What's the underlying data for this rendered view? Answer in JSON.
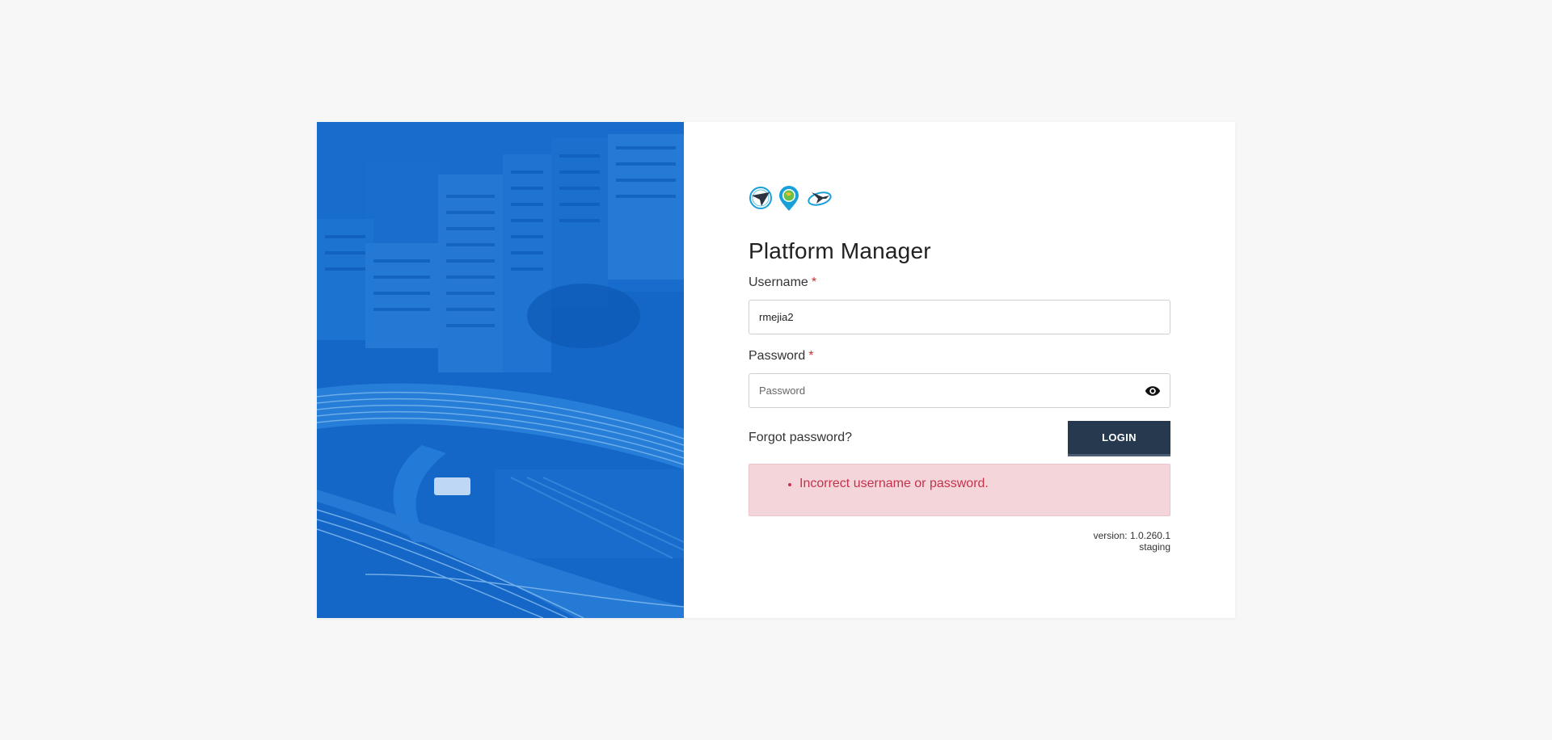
{
  "app": {
    "title": "Platform Manager"
  },
  "form": {
    "username_label": "Username",
    "username_required": "*",
    "username_value": "rmejia2",
    "password_label": "Password",
    "password_required": "*",
    "password_placeholder": "Password",
    "password_value": "",
    "forgot_label": "Forgot password?",
    "login_label": "LOGIN"
  },
  "errors": [
    "Incorrect username or password."
  ],
  "version": {
    "line1": "version: 1.0.260.1",
    "line2": "staging"
  },
  "icons": {
    "logo1": "paper-plane-logo",
    "logo2": "map-pin-globe-logo",
    "logo3": "plane-orbit-logo",
    "eye": "eye-icon"
  },
  "colors": {
    "hero_tint": "#1565c0",
    "button": "#26394f",
    "error_bg": "#f4d6da",
    "error_text": "#c2334d",
    "required": "#d32f2f"
  }
}
